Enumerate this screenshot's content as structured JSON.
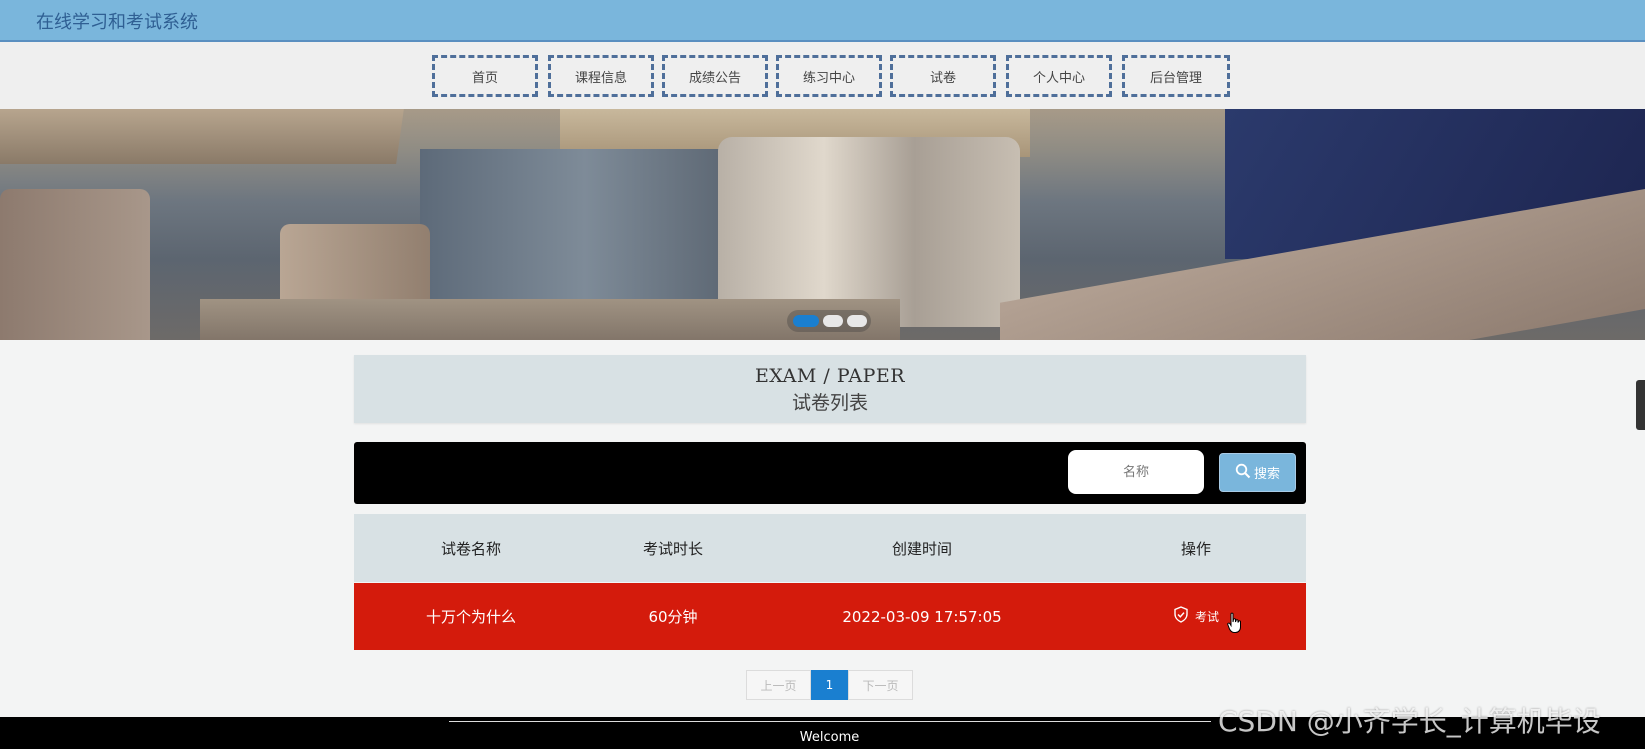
{
  "header": {
    "site_title": "在线学习和考试系统"
  },
  "nav": {
    "items": [
      {
        "label": "首页"
      },
      {
        "label": "课程信息"
      },
      {
        "label": "成绩公告"
      },
      {
        "label": "练习中心"
      },
      {
        "label": "试卷"
      },
      {
        "label": "个人中心"
      },
      {
        "label": "后台管理"
      }
    ]
  },
  "banner": {
    "slide_count": 3,
    "active_slide": 1
  },
  "section": {
    "title_en": "EXAM / PAPER",
    "title_cn": "试卷列表"
  },
  "search": {
    "placeholder": "名称",
    "button_label": "搜索",
    "button_icon": "search-icon"
  },
  "table": {
    "columns": [
      "试卷名称",
      "考试时长",
      "创建时间",
      "操作"
    ],
    "rows": [
      {
        "name": "十万个为什么",
        "duration": "60分钟",
        "created": "2022-03-09 17:57:05",
        "action_label": "考试",
        "action_icon": "shield-check-icon"
      }
    ]
  },
  "pagination": {
    "prev_label": "上一页",
    "current_page": "1",
    "next_label": "下一页"
  },
  "footer": {
    "text": "Welcome"
  },
  "watermark": {
    "text": "CSDN @小齐学长_计算机毕设"
  },
  "colors": {
    "topbar": "#7ab6dc",
    "accent": "#1a7fd0",
    "row_highlight": "#d41b0c",
    "header_bg": "#d8e1e4"
  }
}
